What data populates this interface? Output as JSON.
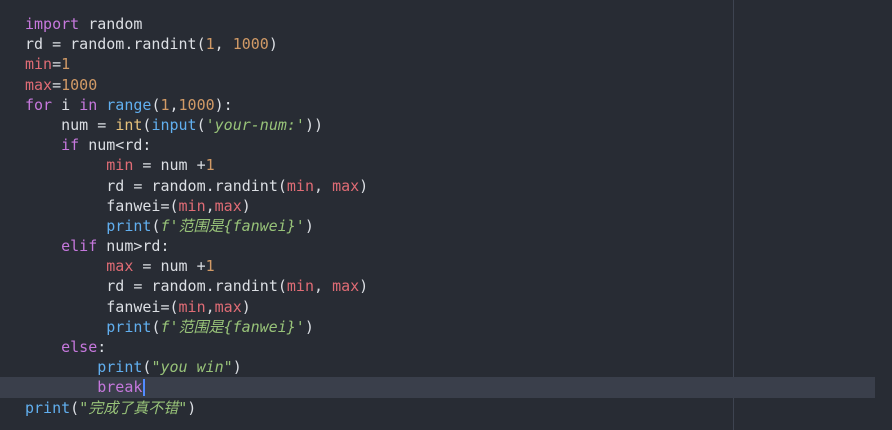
{
  "code_lines": [
    [
      {
        "t": "import",
        "c": "kw"
      },
      {
        "t": " random",
        "c": "pl"
      }
    ],
    [
      {
        "t": "rd = random.randint(",
        "c": "pl"
      },
      {
        "t": "1",
        "c": "num"
      },
      {
        "t": ", ",
        "c": "pl"
      },
      {
        "t": "1000",
        "c": "num"
      },
      {
        "t": ")",
        "c": "pl"
      }
    ],
    [
      {
        "t": "min",
        "c": "var"
      },
      {
        "t": "=",
        "c": "pl"
      },
      {
        "t": "1",
        "c": "num"
      }
    ],
    [
      {
        "t": "max",
        "c": "var"
      },
      {
        "t": "=",
        "c": "pl"
      },
      {
        "t": "1000",
        "c": "num"
      }
    ],
    [
      {
        "t": "for",
        "c": "kw"
      },
      {
        "t": " i ",
        "c": "pl"
      },
      {
        "t": "in",
        "c": "kw"
      },
      {
        "t": " ",
        "c": "pl"
      },
      {
        "t": "range",
        "c": "fn"
      },
      {
        "t": "(",
        "c": "pl"
      },
      {
        "t": "1",
        "c": "num"
      },
      {
        "t": ",",
        "c": "pl"
      },
      {
        "t": "1000",
        "c": "num"
      },
      {
        "t": "):",
        "c": "pl"
      }
    ],
    [
      {
        "t": "    num = ",
        "c": "pl"
      },
      {
        "t": "int",
        "c": "bi"
      },
      {
        "t": "(",
        "c": "pl"
      },
      {
        "t": "input",
        "c": "fn"
      },
      {
        "t": "(",
        "c": "pl"
      },
      {
        "t": "'your-num:'",
        "c": "str"
      },
      {
        "t": "))",
        "c": "pl"
      }
    ],
    [
      {
        "t": "    ",
        "c": "pl"
      },
      {
        "t": "if",
        "c": "kw"
      },
      {
        "t": " num<rd:",
        "c": "pl"
      }
    ],
    [
      {
        "t": "         ",
        "c": "pl"
      },
      {
        "t": "min",
        "c": "var"
      },
      {
        "t": " = num +",
        "c": "pl"
      },
      {
        "t": "1",
        "c": "num"
      }
    ],
    [
      {
        "t": "         rd = random.randint(",
        "c": "pl"
      },
      {
        "t": "min",
        "c": "var"
      },
      {
        "t": ", ",
        "c": "pl"
      },
      {
        "t": "max",
        "c": "var"
      },
      {
        "t": ")",
        "c": "pl"
      }
    ],
    [
      {
        "t": "         fanwei=(",
        "c": "pl"
      },
      {
        "t": "min",
        "c": "var"
      },
      {
        "t": ",",
        "c": "pl"
      },
      {
        "t": "max",
        "c": "var"
      },
      {
        "t": ")",
        "c": "pl"
      }
    ],
    [
      {
        "t": "         ",
        "c": "pl"
      },
      {
        "t": "print",
        "c": "fn"
      },
      {
        "t": "(",
        "c": "pl"
      },
      {
        "t": "f'范围是{fanwei}'",
        "c": "str"
      },
      {
        "t": ")",
        "c": "pl"
      }
    ],
    [
      {
        "t": "    ",
        "c": "pl"
      },
      {
        "t": "elif",
        "c": "kw"
      },
      {
        "t": " num>rd:",
        "c": "pl"
      }
    ],
    [
      {
        "t": "         ",
        "c": "pl"
      },
      {
        "t": "max",
        "c": "var"
      },
      {
        "t": " = num +",
        "c": "pl"
      },
      {
        "t": "1",
        "c": "num"
      }
    ],
    [
      {
        "t": "         rd = random.randint(",
        "c": "pl"
      },
      {
        "t": "min",
        "c": "var"
      },
      {
        "t": ", ",
        "c": "pl"
      },
      {
        "t": "max",
        "c": "var"
      },
      {
        "t": ")",
        "c": "pl"
      }
    ],
    [
      {
        "t": "         fanwei=(",
        "c": "pl"
      },
      {
        "t": "min",
        "c": "var"
      },
      {
        "t": ",",
        "c": "pl"
      },
      {
        "t": "max",
        "c": "var"
      },
      {
        "t": ")",
        "c": "pl"
      }
    ],
    [
      {
        "t": "         ",
        "c": "pl"
      },
      {
        "t": "print",
        "c": "fn"
      },
      {
        "t": "(",
        "c": "pl"
      },
      {
        "t": "f'范围是{fanwei}'",
        "c": "str"
      },
      {
        "t": ")",
        "c": "pl"
      }
    ],
    [
      {
        "t": "    ",
        "c": "kw"
      },
      {
        "t": "else",
        "c": "kw"
      },
      {
        "t": ":",
        "c": "pl"
      }
    ],
    [
      {
        "t": "        ",
        "c": "pl"
      },
      {
        "t": "print",
        "c": "fn"
      },
      {
        "t": "(",
        "c": "pl"
      },
      {
        "t": "\"you win\"",
        "c": "str"
      },
      {
        "t": ")",
        "c": "pl"
      }
    ],
    [
      {
        "t": "        ",
        "c": "pl"
      },
      {
        "t": "break",
        "c": "kw"
      }
    ],
    [
      {
        "t": "print",
        "c": "fn"
      },
      {
        "t": "(",
        "c": "pl"
      },
      {
        "t": "\"完成了真不错\"",
        "c": "str"
      },
      {
        "t": ")",
        "c": "pl"
      }
    ]
  ],
  "current_line_index": 18,
  "colors": {
    "background": "#282c34",
    "keyword": "#c678dd",
    "function": "#61afef",
    "builtin": "#e5c07b",
    "number": "#d19a66",
    "variable": "#e06c75",
    "string": "#98c379",
    "current_line": "#3a3f4b",
    "cursor": "#528bff"
  },
  "icons": {
    "cursor": "text-cursor-icon"
  }
}
